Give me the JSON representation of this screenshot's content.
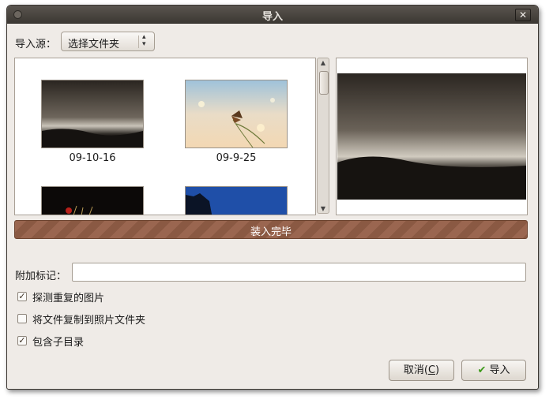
{
  "window": {
    "title": "导入",
    "close_label": "✕"
  },
  "source": {
    "label": "导入源：",
    "selected": "选择文件夹"
  },
  "thumbnails": [
    {
      "label": "09-10-16",
      "icon": "landscape-photo"
    },
    {
      "label": "09-9-25",
      "icon": "butterfly-photo"
    },
    {
      "label": "",
      "icon": "dark-flower-photo"
    },
    {
      "label": "",
      "icon": "blue-sky-photo"
    }
  ],
  "progress": {
    "label": "装入完毕",
    "value": 1.0
  },
  "tags": {
    "label": "附加标记：",
    "value": ""
  },
  "options": [
    {
      "label": "探测重复的图片",
      "checked": true
    },
    {
      "label": "将文件复制到照片文件夹",
      "checked": false
    },
    {
      "label": "包含子目录",
      "checked": true
    }
  ],
  "buttons": {
    "cancel": "取消(",
    "cancel_key": "C",
    "cancel_end": ")",
    "import": "导入"
  },
  "colors": {
    "titlebar": "#3c3833",
    "progress": "#9a6650",
    "window": "#efebe7"
  }
}
